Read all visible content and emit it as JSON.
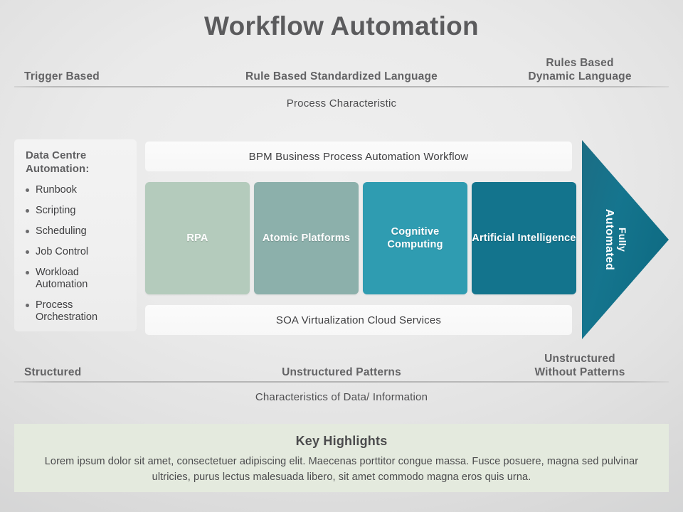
{
  "title": "Workflow Automation",
  "top_axis": {
    "left": "Trigger Based",
    "center": "Rule Based Standardized Language",
    "right_line1": "Rules Based",
    "right_line2": "Dynamic Language",
    "caption": "Process Characteristic"
  },
  "bottom_axis": {
    "left": "Structured",
    "center": "Unstructured Patterns",
    "right_line1": "Unstructured",
    "right_line2": "Without Patterns",
    "caption": "Characteristics of Data/ Information"
  },
  "sidebar": {
    "title": "Data Centre Automation:",
    "items": [
      "Runbook",
      "Scripting",
      "Scheduling",
      "Job Control",
      "Workload Automation",
      "Process Orchestration"
    ]
  },
  "center": {
    "top_bar": "BPM Business Process Automation Workflow",
    "bottom_bar": "SOA Virtualization Cloud Services",
    "boxes": [
      {
        "label": "RPA",
        "color": "#b4cbbc"
      },
      {
        "label": "Atomic Platforms",
        "color": "#8cb0ab"
      },
      {
        "label": "Cognitive Computing",
        "color": "#2f9cb1"
      },
      {
        "label": "Artificial Intelligence",
        "color": "#13748d"
      }
    ]
  },
  "arrow": {
    "line1": "Fully",
    "line2": "Automated",
    "color": "#156e86"
  },
  "highlights": {
    "title": "Key Highlights",
    "body": "Lorem ipsum dolor sit amet, consectetuer adipiscing elit. Maecenas porttitor congue massa. Fusce posuere, magna sed pulvinar ultricies, purus lectus malesuada libero, sit amet commodo magna eros quis urna."
  }
}
